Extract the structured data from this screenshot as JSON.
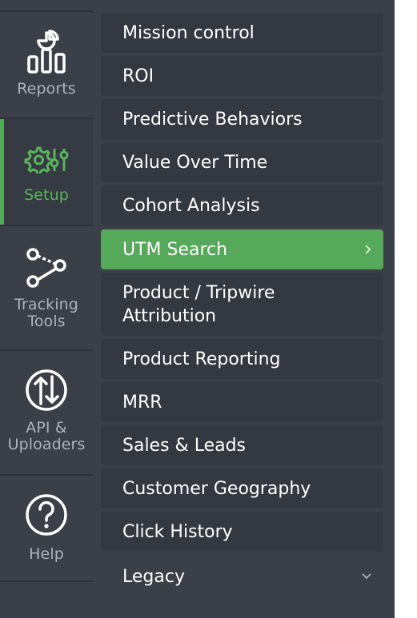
{
  "rail": {
    "items": [
      {
        "label": "Reports",
        "icon": "reports-chart-icon"
      },
      {
        "label": "Setup",
        "icon": "gear-sliders-icon",
        "active": true
      },
      {
        "label": "Tracking Tools",
        "icon": "tracking-nodes-icon"
      },
      {
        "label": "API & Uploaders",
        "icon": "up-down-arrows-icon"
      },
      {
        "label": "Help",
        "icon": "question-circle-icon"
      }
    ]
  },
  "menu": {
    "items": [
      {
        "label": "Mission control"
      },
      {
        "label": "ROI"
      },
      {
        "label": "Predictive Behaviors"
      },
      {
        "label": "Value Over Time"
      },
      {
        "label": "Cohort Analysis"
      },
      {
        "label": "UTM Search",
        "active": true,
        "icon": "chevron-right-icon"
      },
      {
        "label": "Product / Tripwire Attribution"
      },
      {
        "label": "Product Reporting"
      },
      {
        "label": "MRR"
      },
      {
        "label": "Sales & Leads"
      },
      {
        "label": "Customer Geography"
      },
      {
        "label": "Click History"
      },
      {
        "label": "Legacy",
        "icon": "chevron-down-icon"
      }
    ]
  },
  "colors": {
    "accent": "#56a85a",
    "rail_bg": "#3a3f48",
    "item_bg": "#333841",
    "active_text": "#5ab35d"
  }
}
